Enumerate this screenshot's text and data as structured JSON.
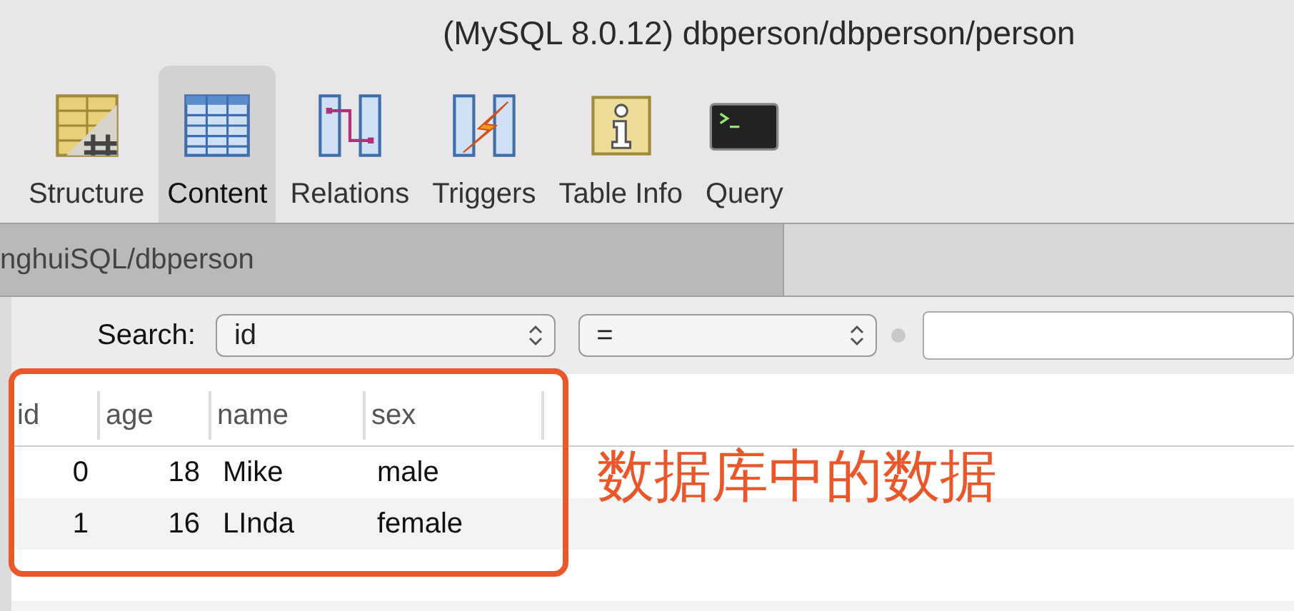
{
  "window": {
    "title": "(MySQL 8.0.12) dbperson/dbperson/person"
  },
  "toolbar": [
    {
      "kind": "structure",
      "label": "Structure",
      "selected": false
    },
    {
      "kind": "content",
      "label": "Content",
      "selected": true
    },
    {
      "kind": "relations",
      "label": "Relations",
      "selected": false
    },
    {
      "kind": "triggers",
      "label": "Triggers",
      "selected": false
    },
    {
      "kind": "info",
      "label": "Table Info",
      "selected": false
    },
    {
      "kind": "query",
      "label": "Query",
      "selected": false
    }
  ],
  "tabs": [
    {
      "label": "nghuiSQL/dbperson",
      "selected": true
    }
  ],
  "search": {
    "label": "Search:",
    "field": "id",
    "operator": "="
  },
  "table": {
    "columns": [
      "id",
      "age",
      "name",
      "sex"
    ],
    "rows": [
      [
        "0",
        "18",
        "Mike",
        "male"
      ],
      [
        "1",
        "16",
        "LInda",
        "female"
      ]
    ]
  },
  "annotation": {
    "text": "数据库中的数据"
  }
}
